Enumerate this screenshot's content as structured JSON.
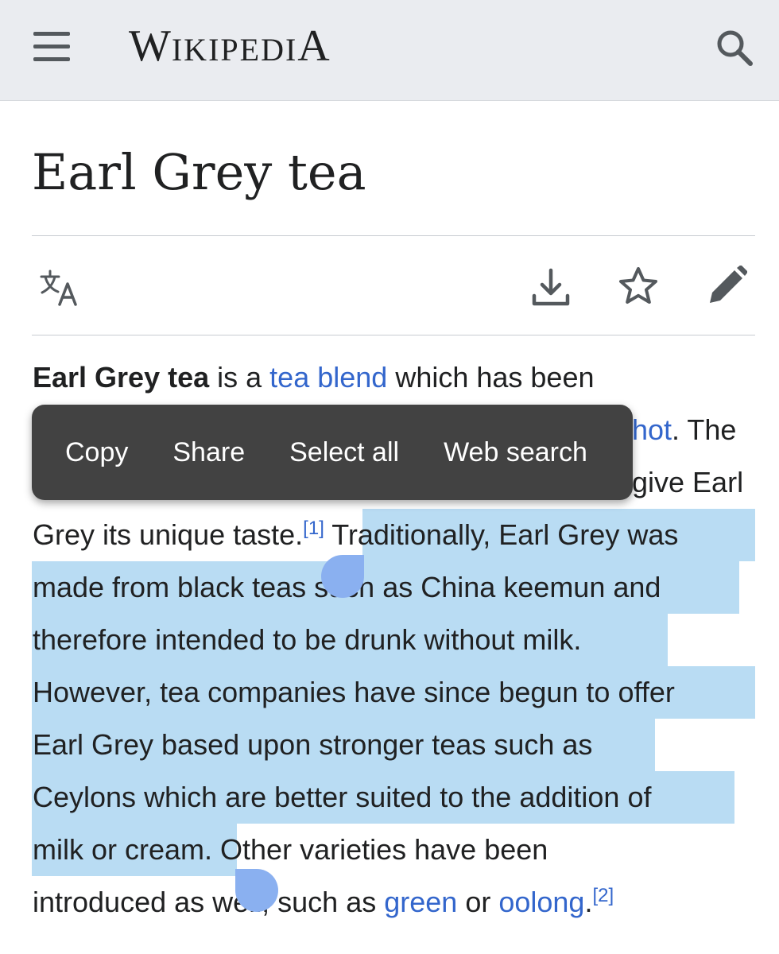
{
  "header": {
    "logo": {
      "first": "W",
      "small1": "IKIPEDI",
      "last": "A"
    }
  },
  "article": {
    "title": "Earl Grey tea"
  },
  "lines": [
    {
      "segments": [
        {
          "t": "b",
          "v": "Earl Grey tea"
        },
        {
          "t": "s",
          "v": " is a "
        },
        {
          "t": "a",
          "v": "tea blend"
        },
        {
          "t": "s",
          "v": " which has been"
        }
      ]
    },
    {
      "segments": [
        {
          "t": "a",
          "v": "hot"
        },
        {
          "t": "s",
          "v": ". The"
        }
      ]
    },
    {
      "segments": [
        {
          "t": "s",
          "v": "give Earl"
        }
      ]
    },
    {
      "segments": [
        {
          "t": "s",
          "v": "Grey its unique taste."
        },
        {
          "t": "r",
          "v": "[1]"
        },
        {
          "t": "s",
          "v": " Traditionally, Earl Grey was"
        }
      ]
    },
    {
      "segments": [
        {
          "t": "s",
          "v": "made from black teas such as China keemun and"
        }
      ]
    },
    {
      "segments": [
        {
          "t": "s",
          "v": "therefore intended to be drunk without milk."
        }
      ]
    },
    {
      "segments": [
        {
          "t": "s",
          "v": "However, tea companies have since begun to offer"
        }
      ]
    },
    {
      "segments": [
        {
          "t": "s",
          "v": "Earl Grey based upon stronger teas such as"
        }
      ]
    },
    {
      "segments": [
        {
          "t": "s",
          "v": "Ceylons which are better suited to the addition of"
        }
      ]
    },
    {
      "segments": [
        {
          "t": "s",
          "v": "milk or cream."
        },
        {
          "t": "s",
          "v": " Other varieties have been"
        }
      ]
    },
    {
      "segments": [
        {
          "t": "s",
          "v": "introduced as well, such as "
        },
        {
          "t": "a",
          "v": "green"
        },
        {
          "t": "s",
          "v": " or "
        },
        {
          "t": "a",
          "v": "oolong"
        },
        {
          "t": "s",
          "v": "."
        },
        {
          "t": "r",
          "v": "[2]"
        }
      ]
    }
  ],
  "context_menu": {
    "items": [
      "Copy",
      "Share",
      "Select all",
      "Web search"
    ]
  },
  "colors": {
    "link": "#3366cc",
    "selection": "#b9dcf3",
    "handle": "#8ab0f0",
    "menu_bg": "#424242",
    "header_bg": "#eaecf0"
  }
}
